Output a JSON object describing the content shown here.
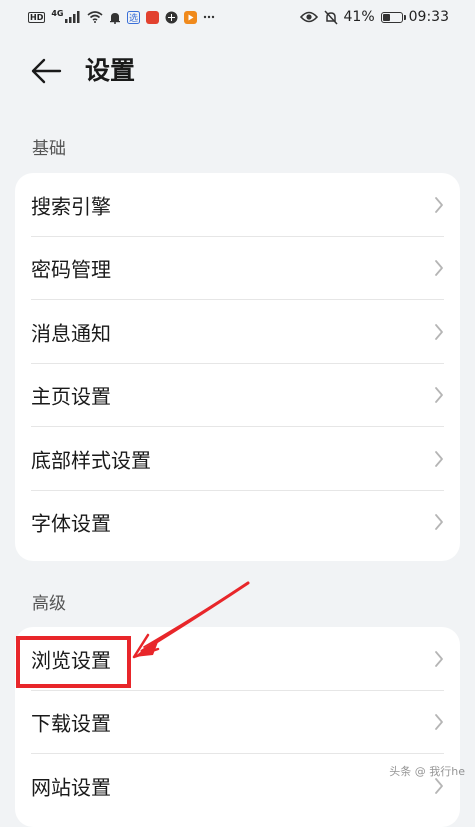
{
  "status_bar": {
    "left_labels": [
      "HD",
      "4G"
    ],
    "battery_text": "41%",
    "battery_level": 0.41,
    "time": "09:33",
    "app_icon_colors": [
      "#e2412f",
      "#f08a1c"
    ]
  },
  "header": {
    "title": "设置"
  },
  "sections": [
    {
      "label": "基础",
      "items": [
        "搜索引擎",
        "密码管理",
        "消息通知",
        "主页设置",
        "底部样式设置",
        "字体设置"
      ]
    },
    {
      "label": "高级",
      "items": [
        "浏览设置",
        "下载设置",
        "网站设置"
      ]
    }
  ],
  "annotation": {
    "color": "#e8262a",
    "highlighted_item": "浏览设置"
  },
  "watermark": {
    "text": "头条 @ 我行he"
  }
}
